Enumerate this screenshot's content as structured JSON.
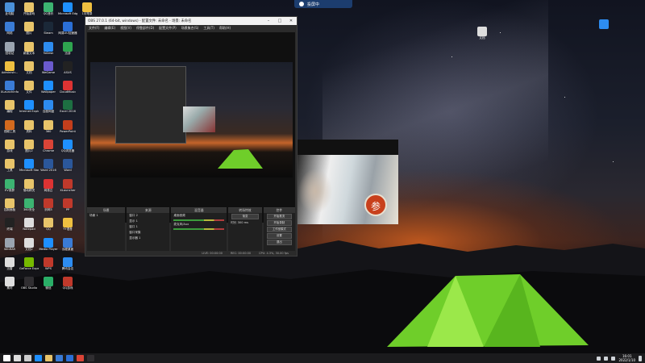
{
  "desktop_icons": [
    {
      "label": "此电脑",
      "color": "#4a90d9"
    },
    {
      "label": "开始游戏",
      "color": "#e8c46a"
    },
    {
      "label": "QQ音乐",
      "color": "#3cb371"
    },
    {
      "label": "Microsoft Edge",
      "color": "#1e90ff"
    },
    {
      "label": "1月笔录",
      "color": "#f0c040"
    },
    {
      "label": "网络",
      "color": "#3a7bd5"
    },
    {
      "label": "图片",
      "color": "#e8c46a"
    },
    {
      "label": "Steam",
      "color": "#1b2838"
    },
    {
      "label": "网易UU加速器",
      "color": "#2b6fd6"
    },
    {
      "label": "",
      "color": "rgba(0,0,0,0)"
    },
    {
      "label": "回收站",
      "color": "#9aa4b0"
    },
    {
      "label": "新建文本",
      "color": "#e8c46a"
    },
    {
      "label": "ToDesk",
      "color": "#2d8cf0"
    },
    {
      "label": "迅游",
      "color": "#2ea44f"
    },
    {
      "label": "",
      "color": "rgba(0,0,0,0)"
    },
    {
      "label": "Administr...",
      "color": "#f0c040"
    },
    {
      "label": "文档",
      "color": "#e8c46a"
    },
    {
      "label": "WeGame",
      "color": "#6a5acd"
    },
    {
      "label": "ASUS",
      "color": "#222"
    },
    {
      "label": "",
      "color": "rgba(0,0,0,0)"
    },
    {
      "label": "XLaunchInfo",
      "color": "#3a7bd5"
    },
    {
      "label": "文件",
      "color": "#e8c46a"
    },
    {
      "label": "Wallpaper",
      "color": "#1e90ff"
    },
    {
      "label": "CloudMusic",
      "color": "#d33"
    },
    {
      "label": "",
      "color": "rgba(0,0,0,0)"
    },
    {
      "label": "编程",
      "color": "#e8c46a"
    },
    {
      "label": "Internet Explorer",
      "color": "#1e90ff"
    },
    {
      "label": "百度网盘",
      "color": "#2d8cf0"
    },
    {
      "label": "Excel 2016",
      "color": "#1d6f42"
    },
    {
      "label": "",
      "color": "rgba(0,0,0,0)"
    },
    {
      "label": "视频工具",
      "color": "#d2691e"
    },
    {
      "label": "资料",
      "color": "#e8c46a"
    },
    {
      "label": "360",
      "color": "#e8c46a"
    },
    {
      "label": "PowerPoint",
      "color": "#c43e1c"
    },
    {
      "label": "",
      "color": "rgba(0,0,0,0)"
    },
    {
      "label": "游戏",
      "color": "#e8c46a"
    },
    {
      "label": "图片2",
      "color": "#e8c46a"
    },
    {
      "label": "Chrome",
      "color": "#db4437"
    },
    {
      "label": "QQ浏览器",
      "color": "#1e90ff"
    },
    {
      "label": "",
      "color": "rgba(0,0,0,0)"
    },
    {
      "label": "工具",
      "color": "#e8c46a"
    },
    {
      "label": "Microsoft Store",
      "color": "#1e90ff"
    },
    {
      "label": "Word 2016",
      "color": "#2b579a"
    },
    {
      "label": "Word",
      "color": "#2b579a"
    },
    {
      "label": "",
      "color": "rgba(0,0,0,0)"
    },
    {
      "label": "EV录屏",
      "color": "#3cb371"
    },
    {
      "label": "驱动精灵",
      "color": "#e8c46a"
    },
    {
      "label": "网易云",
      "color": "#d33"
    },
    {
      "label": "XLauncher",
      "color": "#c0392b"
    },
    {
      "label": "",
      "color": "rgba(0,0,0,0)"
    },
    {
      "label": "控制面板",
      "color": "#e8c46a"
    },
    {
      "label": "360安全",
      "color": "#3cb371"
    },
    {
      "label": "剑网3",
      "color": "#c0392b"
    },
    {
      "label": "PP",
      "color": "#c0392b"
    },
    {
      "label": "",
      "color": "rgba(0,0,0,0)"
    },
    {
      "label": "终端",
      "color": "#222"
    },
    {
      "label": "Notepad",
      "color": "#ddd"
    },
    {
      "label": "QQ",
      "color": "#e8c46a"
    },
    {
      "label": "YY语音",
      "color": "#f0c040"
    },
    {
      "label": "",
      "color": "rgba(0,0,0,0)"
    },
    {
      "label": "WinRAR",
      "color": "#9aa4b0"
    },
    {
      "label": "文档2",
      "color": "#ddd"
    },
    {
      "label": "Media Player",
      "color": "#1e90ff"
    },
    {
      "label": "远程桌面",
      "color": "#3a7bd5"
    },
    {
      "label": "",
      "color": "rgba(0,0,0,0)"
    },
    {
      "label": "迅雷",
      "color": "#ddd"
    },
    {
      "label": "GeForce Experience",
      "color": "#76b900"
    },
    {
      "label": "WPS",
      "color": "#c0392b"
    },
    {
      "label": "腾讯会议",
      "color": "#2d8cf0"
    },
    {
      "label": "",
      "color": "rgba(0,0,0,0)"
    },
    {
      "label": "素材",
      "color": "#ddd"
    },
    {
      "label": "OBS Studio",
      "color": "#302e31"
    },
    {
      "label": "微信",
      "color": "#2aae67"
    },
    {
      "label": "QQ游戏",
      "color": "#c0392b"
    },
    {
      "label": "",
      "color": "rgba(0,0,0,0)"
    }
  ],
  "right_icons": [
    {
      "label": "文档",
      "color": "#ddd"
    },
    {
      "label": "",
      "color": "#2d8cf0"
    }
  ],
  "rec_pill": {
    "label": "投屏中"
  },
  "obs": {
    "title": "OBS 27.0.1 (64-bit, windows) - 配置文件: 未命名 - 场景: 未命名",
    "menu": [
      "文件(F)",
      "编辑(E)",
      "视图(V)",
      "停靠部件(D)",
      "配置文件(P)",
      "场景集合(S)",
      "工具(T)",
      "帮助(H)"
    ],
    "docks": {
      "scenes": {
        "title": "场景",
        "items": [
          "场景 1"
        ]
      },
      "sources": {
        "title": "来源",
        "items": [
          "窗口 2",
          "显示 1",
          "窗口 1",
          "窗口采集",
          "显示器 1"
        ]
      },
      "mixer": {
        "title": "混音器",
        "channels": [
          "桌面音频",
          "麦克风/Aux"
        ]
      },
      "transitions": {
        "title": "转场特效",
        "type": "渐变",
        "duration_label": "时长",
        "duration": "300 ms"
      },
      "controls": {
        "title": "控件",
        "buttons": [
          "开始推流",
          "开始录制",
          "工作室模式",
          "设置",
          "退出"
        ]
      }
    },
    "status": [
      "LIVE: 00:00:00",
      "REC: 00:00:00",
      "CPU: 4.3%, 30.00 fps"
    ]
  },
  "game": {
    "emblem": "参"
  },
  "taskbar": {
    "time": "16:01",
    "date": "2022/1/10",
    "apps": [
      "start",
      "search",
      "task-view",
      "edge",
      "explorer",
      "store",
      "mail",
      "chrome",
      "obs"
    ]
  }
}
